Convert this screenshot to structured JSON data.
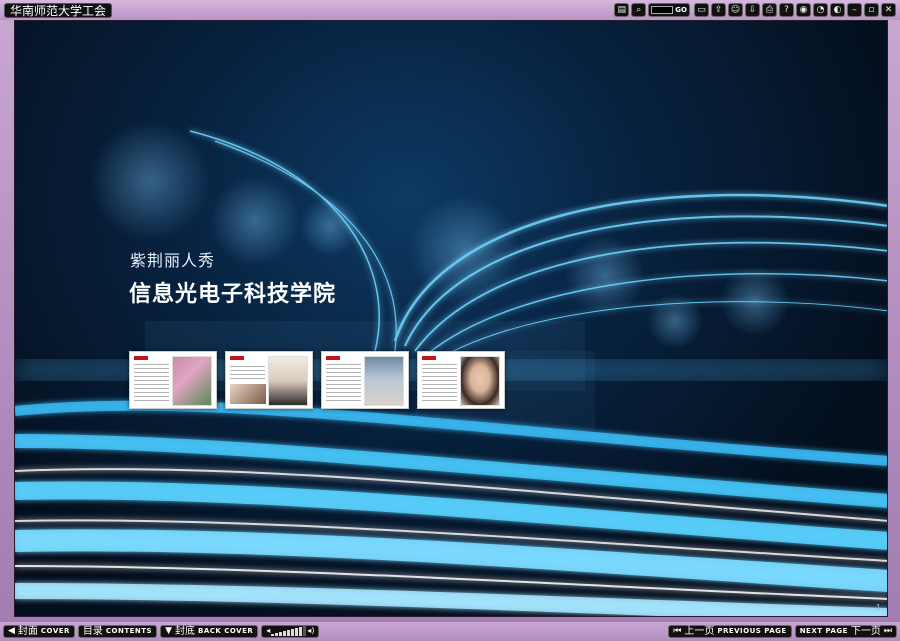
{
  "app_title": "华南师范大学工会",
  "toolbar": {
    "goto_label": "GO",
    "buttons": [
      {
        "name": "thumbnails-icon",
        "glyph": "▤"
      },
      {
        "name": "zoom-icon",
        "glyph": "⌕"
      },
      {
        "name": "comment-icon",
        "glyph": "▭"
      },
      {
        "name": "share-icon",
        "glyph": "⇪"
      },
      {
        "name": "user-icon",
        "glyph": "☺"
      },
      {
        "name": "download-icon",
        "glyph": "⇩"
      },
      {
        "name": "print-icon",
        "glyph": "⎙"
      },
      {
        "name": "help-icon",
        "glyph": "?"
      },
      {
        "name": "settings-icon",
        "glyph": "◉"
      },
      {
        "name": "autoplay-icon",
        "glyph": "◔"
      },
      {
        "name": "sound-icon",
        "glyph": "◐"
      },
      {
        "name": "minimize-icon",
        "glyph": "–"
      },
      {
        "name": "maximize-icon",
        "glyph": "▫"
      },
      {
        "name": "close-icon",
        "glyph": "✕"
      }
    ]
  },
  "page": {
    "subtitle": "紫荆丽人秀",
    "title": "信息光电子科技学院",
    "page_number": "1"
  },
  "thumbnails": [
    {
      "photo_color": "#c98aa8",
      "photo_color2": "#5a8a5a"
    },
    {
      "photo_color": "#e8d7c7",
      "photo_color2": "#7d5a45"
    },
    {
      "photo_color": "#6f8aa5",
      "photo_color2": "#d9d3c8"
    },
    {
      "photo_color": "#d9b59a",
      "photo_color2": "#3a2a24"
    }
  ],
  "bottombar": {
    "cover_zh": "封面",
    "cover_en": "COVER",
    "contents_zh": "目录",
    "contents_en": "CONTENTS",
    "back_zh": "封底",
    "back_en": "BACK COVER",
    "prev_zh": "上一页",
    "prev_en": "PREVIOUS PAGE",
    "next_en": "NEXT PAGE",
    "next_zh": "下一页",
    "volume_level": 0.8
  },
  "colors": {
    "stage_dark": "#040f1e",
    "glow": "#40c8ff",
    "chrome": "#b894c4",
    "accent_red": "#c2151b"
  }
}
